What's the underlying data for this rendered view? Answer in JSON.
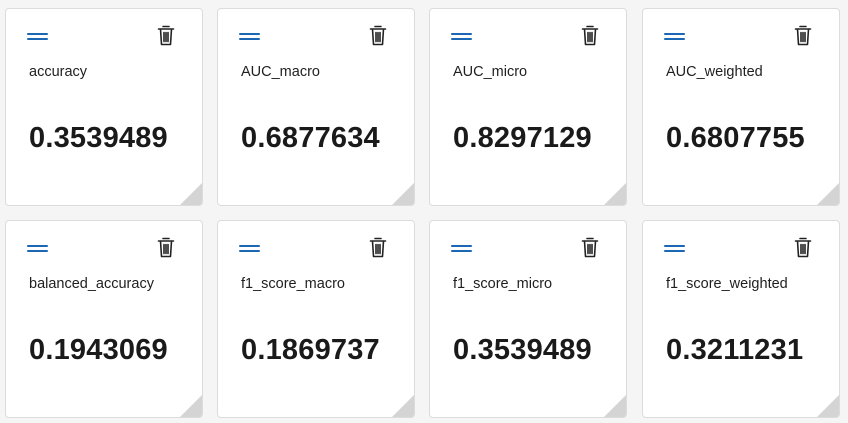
{
  "colors": {
    "accent": "#1b67b3",
    "card_background": "#ffffff",
    "page_background": "#f5f5f5"
  },
  "icons": {
    "drag": "drag-handle-icon",
    "delete": "trash-icon",
    "resize": "resize-grip"
  },
  "cards": [
    {
      "name": "accuracy",
      "value": "0.3539489"
    },
    {
      "name": "AUC_macro",
      "value": "0.6877634"
    },
    {
      "name": "AUC_micro",
      "value": "0.8297129"
    },
    {
      "name": "AUC_weighted",
      "value": "0.6807755"
    },
    {
      "name": "balanced_accuracy",
      "value": "0.1943069"
    },
    {
      "name": "f1_score_macro",
      "value": "0.1869737"
    },
    {
      "name": "f1_score_micro",
      "value": "0.3539489"
    },
    {
      "name": "f1_score_weighted",
      "value": "0.3211231"
    }
  ]
}
